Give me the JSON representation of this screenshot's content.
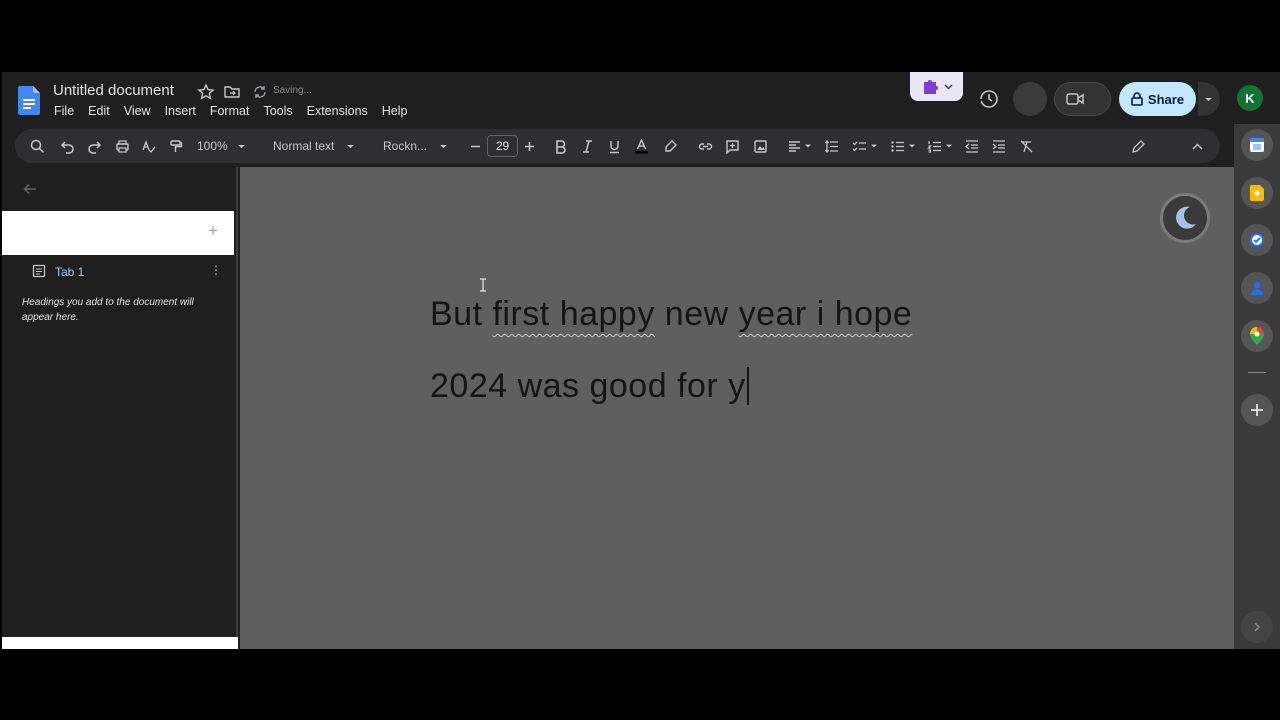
{
  "header": {
    "title": "Untitled document",
    "saving": "Saving...",
    "share_label": "Share",
    "user_initial": "K"
  },
  "menu": [
    "File",
    "Edit",
    "View",
    "Insert",
    "Format",
    "Tools",
    "Extensions",
    "Help"
  ],
  "toolbar": {
    "zoom": "100%",
    "style": "Normal text",
    "font": "Rockn...",
    "font_size": "29"
  },
  "left_panel": {
    "tab_label": "Tab 1",
    "add_symbol": "+",
    "more_symbol": "⋮",
    "hint": "Headings you add to the document will appear here."
  },
  "document": {
    "line1_a": "But ",
    "line1_b": "first happy",
    "line1_c": " new ",
    "line1_d": "year i hope",
    "line2": "2024 was good for y"
  },
  "colors": {
    "background": "#1f1f1f",
    "canvas": "#5f5f5f",
    "share": "#c2e7ff",
    "avatar": "#137333"
  }
}
